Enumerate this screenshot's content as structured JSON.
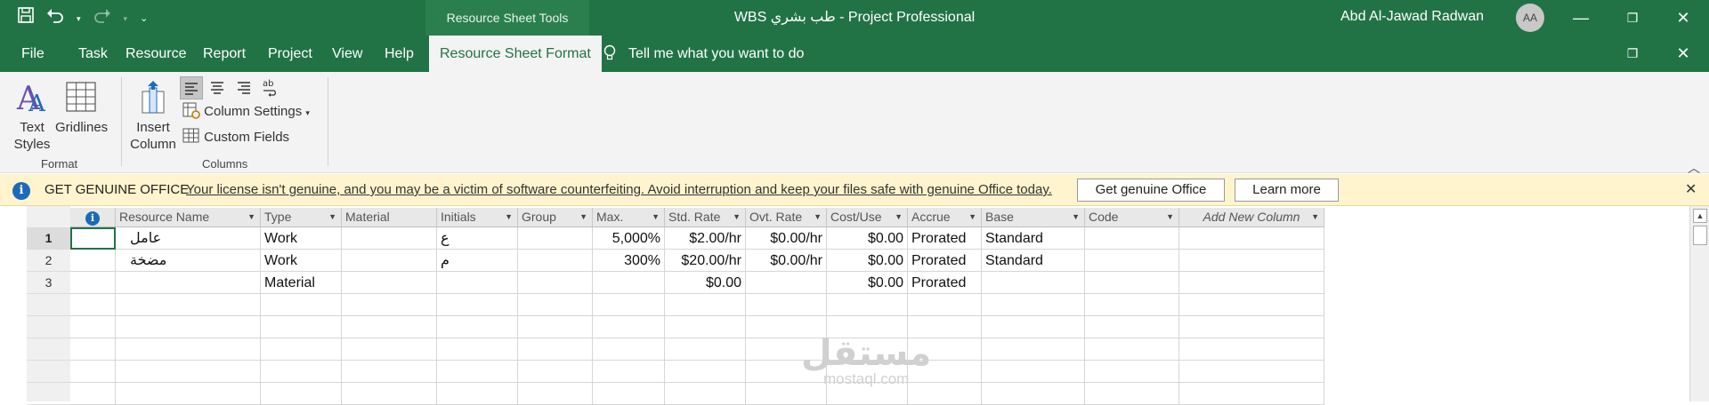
{
  "titlebar": {
    "context_tab": "Resource Sheet Tools",
    "doc_title": "WBS طب بشري  -  Project Professional",
    "user_name": "Abd Al-Jawad Radwan",
    "avatar_initials": "AA",
    "qat": {
      "save_icon": "save-icon",
      "undo_icon": "undo-icon",
      "redo_icon": "redo-icon",
      "customize_icon": "customize-qat-icon"
    }
  },
  "tabs": [
    {
      "label": "File"
    },
    {
      "label": "Task"
    },
    {
      "label": "Resource"
    },
    {
      "label": "Report"
    },
    {
      "label": "Project"
    },
    {
      "label": "View"
    },
    {
      "label": "Help"
    },
    {
      "label": "Resource Sheet Format",
      "active": true
    }
  ],
  "tellme": {
    "placeholder": "Tell me what you want to do"
  },
  "ribbon": {
    "format_group": {
      "label": "Format",
      "text_styles": "Text Styles",
      "gridlines": "Gridlines"
    },
    "columns_group": {
      "label": "Columns",
      "insert_column": "Insert Column",
      "column_settings": "Column Settings",
      "custom_fields": "Custom Fields"
    }
  },
  "genuine_bar": {
    "title": "GET GENUINE OFFICE",
    "message": "Your license isn't genuine, and you may be a victim of software counterfeiting. Avoid interruption and keep your files safe with genuine Office today.",
    "get_button": "Get genuine Office",
    "learn_button": "Learn more"
  },
  "grid": {
    "columns": [
      "Resource Name",
      "Type",
      "Material",
      "Initials",
      "Group",
      "Max.",
      "Std. Rate",
      "Ovt. Rate",
      "Cost/Use",
      "Accrue",
      "Base",
      "Code",
      "Add New Column"
    ],
    "rows": [
      {
        "num": "1",
        "name": "عامل",
        "type": "Work",
        "material": "",
        "initials": "ع",
        "group": "",
        "max": "5,000%",
        "std_rate": "$2.00/hr",
        "ovt_rate": "$0.00/hr",
        "cost_use": "$0.00",
        "accrue": "Prorated",
        "base": "Standard",
        "code": ""
      },
      {
        "num": "2",
        "name": "مضخة",
        "type": "Work",
        "material": "",
        "initials": "م",
        "group": "",
        "max": "300%",
        "std_rate": "$20.00/hr",
        "ovt_rate": "$0.00/hr",
        "cost_use": "$0.00",
        "accrue": "Prorated",
        "base": "Standard",
        "code": ""
      },
      {
        "num": "3",
        "name": "",
        "type": "Material",
        "material": "",
        "initials": "",
        "group": "",
        "max": "",
        "std_rate": "$0.00",
        "ovt_rate": "",
        "cost_use": "$0.00",
        "accrue": "Prorated",
        "base": "",
        "code": ""
      }
    ]
  },
  "watermark": {
    "big": "مستقل",
    "small": "mostaql.com"
  },
  "colors": {
    "brand_green": "#217346",
    "ribbon_bg": "#f3f3f3",
    "warning_bg": "#fff4ce",
    "info_blue": "#1c6bb8"
  }
}
